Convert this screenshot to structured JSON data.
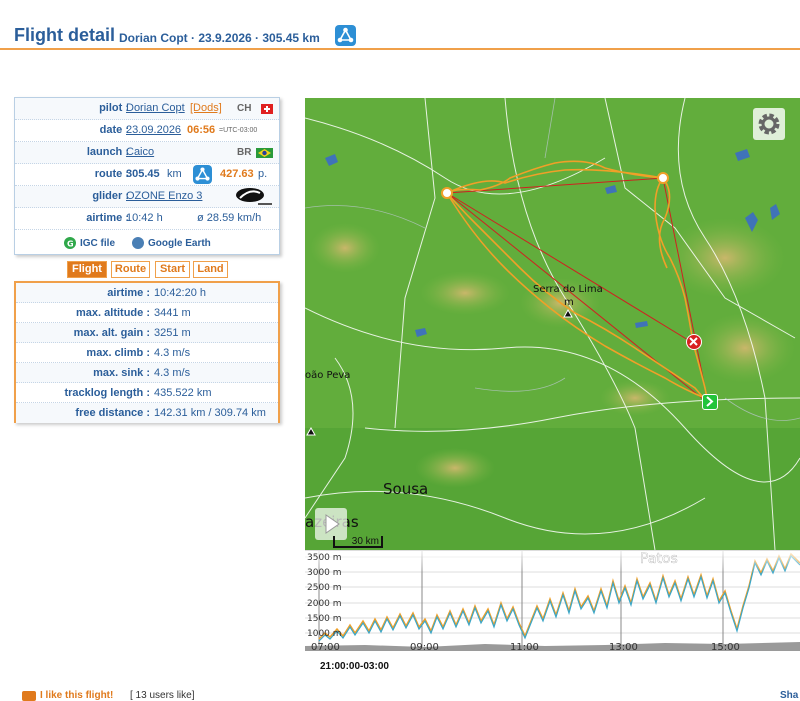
{
  "header": {
    "title": "Flight detail",
    "subtitle": "Dorian Copt · 23.9.2026 · 305.45 km"
  },
  "info": {
    "pilot_label": "pilot :",
    "pilot_name": "Dorian Copt",
    "pilot_team": "[Dods]",
    "pilot_country": "CH",
    "date_label": "date :",
    "date_value": "23.09.2026",
    "time_value": "06:56",
    "tz_value": "=UTC-03:00",
    "launch_label": "launch :",
    "launch_value": "Caico",
    "launch_country": "BR",
    "route_label": "route :",
    "route_km": "305.45",
    "route_unit": "km",
    "route_points": "427.63",
    "points_unit": "p.",
    "glider_label": "glider :",
    "glider_value": "OZONE Enzo 3",
    "airtime_label": "airtime :",
    "airtime_value": "10:42 h",
    "avg_speed": "ø 28.59 km/h",
    "igc_link": "IGC file",
    "earth_link": "Google Earth"
  },
  "tabs": [
    {
      "label": "Flight",
      "active": true
    },
    {
      "label": "Route",
      "active": false
    },
    {
      "label": "Start",
      "active": false
    },
    {
      "label": "Land",
      "active": false
    }
  ],
  "stats": [
    {
      "label": "airtime :",
      "value": "10:42:20 h"
    },
    {
      "label": "max. altitude :",
      "value": "3441 m"
    },
    {
      "label": "max. alt. gain :",
      "value": "3251 m"
    },
    {
      "label": "max. climb :",
      "value": "4.3 m/s"
    },
    {
      "label": "max. sink :",
      "value": "4.3 m/s"
    },
    {
      "label": "tracklog length :",
      "value": "435.522 km"
    },
    {
      "label": "free distance :",
      "value": "142.31 km / 309.74 km"
    }
  ],
  "map": {
    "labels": {
      "serra": "Serra do Lima",
      "sousa": "Sousa",
      "azeiras": "azeiras",
      "patos": "Patos",
      "paopeva": "oão Peva"
    },
    "scale": "30 km"
  },
  "altitude": {
    "y_ticks": [
      "3500 m",
      "3000 m",
      "2500 m",
      "2000 m",
      "1500 m",
      "1000 m"
    ],
    "x_ticks": [
      "07:00",
      "09:00",
      "11:00",
      "13:00",
      "15:00"
    ],
    "time_readout": "21:00:00-03:00"
  },
  "footer": {
    "like": "I like this flight!",
    "count": "[ 13 users like]",
    "share": "Sha"
  },
  "colors": {
    "accent": "#e07a1c",
    "link": "#2b5e9a",
    "track": "#f0a028",
    "route": "#d02020"
  }
}
